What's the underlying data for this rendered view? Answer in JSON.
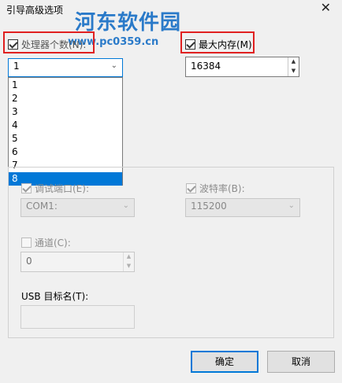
{
  "window": {
    "title": "引导高级选项",
    "close_glyph": "✕"
  },
  "watermark": {
    "text": "河东软件园",
    "url": "www.pc0359.cn"
  },
  "processor_count": {
    "label": "处理器个数(N):",
    "checked": true,
    "selected": "1",
    "options": [
      "1",
      "2",
      "3",
      "4",
      "5",
      "6",
      "7",
      "8"
    ],
    "highlighted": "8"
  },
  "max_memory": {
    "label": "最大内存(M)",
    "checked": true,
    "value": "16384"
  },
  "debug": {
    "port_label": "调试端口(E):",
    "port_value": "COM1:",
    "baud_label": "波特率(B):",
    "baud_value": "115200"
  },
  "channel": {
    "label": "通道(C):",
    "value": "0"
  },
  "usb": {
    "label": "USB 目标名(T):",
    "value": ""
  },
  "buttons": {
    "ok": "确定",
    "cancel": "取消"
  },
  "colors": {
    "highlight": "#e02020",
    "selection": "#0078d7",
    "watermark": "#2a7ac9"
  }
}
